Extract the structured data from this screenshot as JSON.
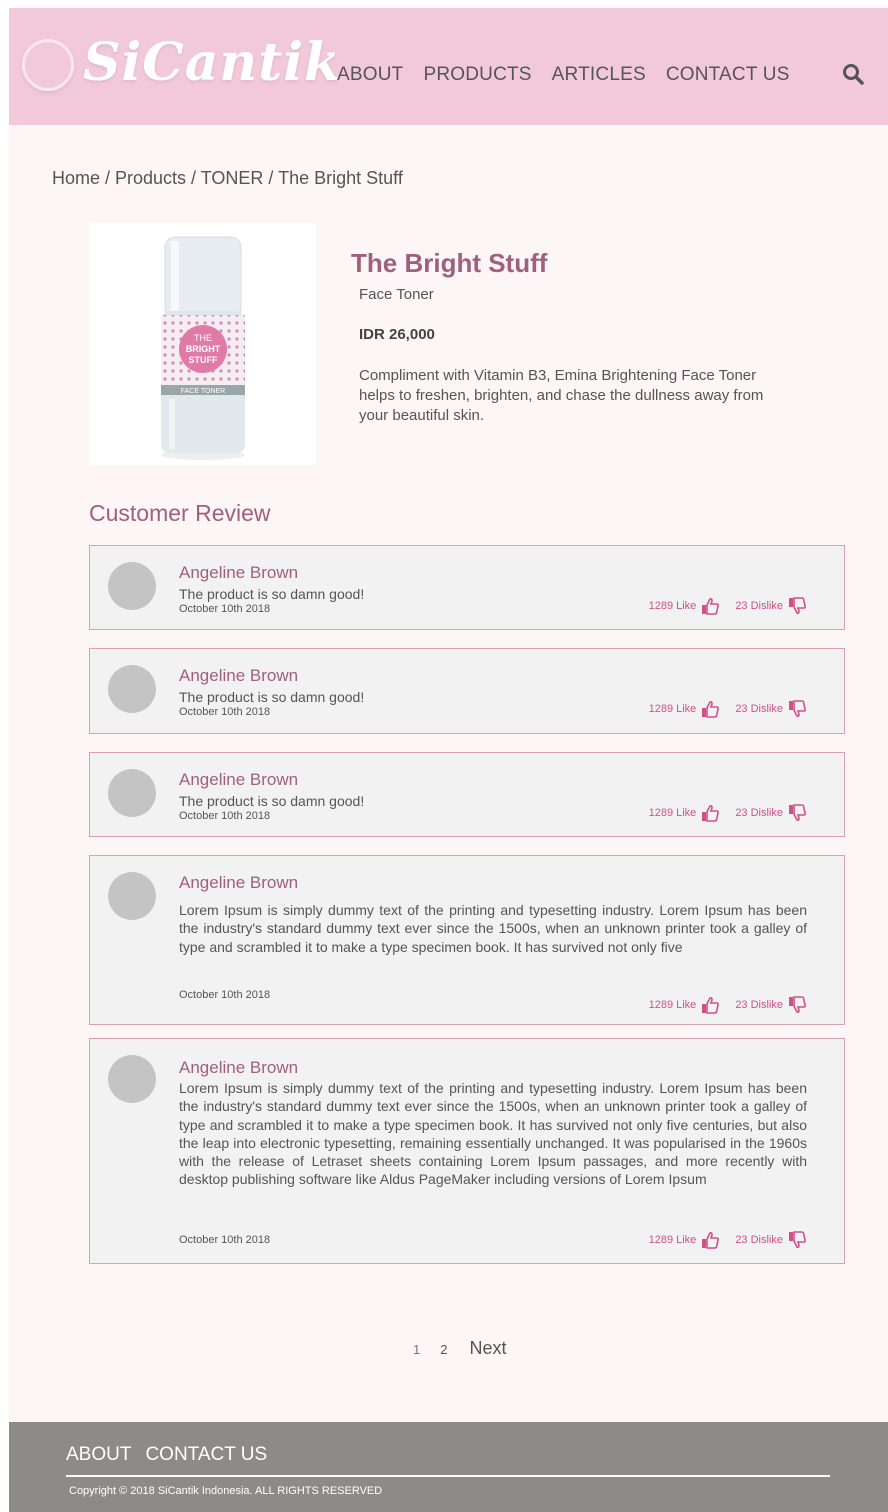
{
  "header": {
    "logo": "SiCantik",
    "nav": [
      "ABOUT",
      "PRODUCTS",
      "ARTICLES",
      "CONTACT US"
    ],
    "search_icon": "search-icon"
  },
  "breadcrumb": "Home / Products / TONER / The Bright Stuff",
  "product": {
    "title": "The Bright Stuff",
    "type": "Face Toner",
    "price": "IDR 26,000",
    "description": "Compliment with Vitamin B3, Emina Brightening Face Toner helps to freshen, brighten, and chase the dullness away from  your beautiful skin.",
    "image_label_1": "THE",
    "image_label_2": "BRIGHT",
    "image_label_3": "STUFF",
    "image_label_4": "FACE TONER"
  },
  "reviews_heading": "Customer Review",
  "reviews": [
    {
      "name": "Angeline Brown",
      "text": "The product is so damn good!",
      "date": "October 10th 2018",
      "likes": "1289 Like",
      "dislikes": "23 Dislike"
    },
    {
      "name": "Angeline Brown",
      "text": "The product is so damn good!",
      "date": "October 10th 2018",
      "likes": "1289 Like",
      "dislikes": "23 Dislike"
    },
    {
      "name": "Angeline Brown",
      "text": "The product is so damn good!",
      "date": "October 10th 2018",
      "likes": "1289 Like",
      "dislikes": "23 Dislike"
    },
    {
      "name": "Angeline Brown",
      "text": "Lorem Ipsum is simply dummy text of the printing and typesetting industry. Lorem Ipsum has been the industry's standard dummy text ever since the 1500s, when an unknown printer took a galley of type and scrambled it to make a type specimen book. It has survived not only five",
      "date": "October 10th 2018",
      "likes": "1289 Like",
      "dislikes": "23 Dislike"
    },
    {
      "name": "Angeline Brown",
      "text": "Lorem Ipsum is simply dummy text of the printing and typesetting industry. Lorem Ipsum has been the industry's standard dummy text ever since the 1500s, when an unknown printer took a galley of type and scrambled it to make a type specimen book. It has survived not only five centuries, but also the leap into electronic typesetting, remaining essentially unchanged. It was popularised in the 1960s with the release of Letraset sheets containing Lorem Ipsum passages, and more recently with desktop publishing software like Aldus PageMaker including versions of Lorem Ipsum",
      "date": "October 10th 2018",
      "likes": "1289 Like",
      "dislikes": "23 Dislike"
    }
  ],
  "pagination": {
    "pages": [
      "1",
      "2"
    ],
    "next": "Next"
  },
  "footer": {
    "links": [
      "ABOUT",
      "CONTACT US"
    ],
    "copyright": "Copyright © 2018 SiCantik Indonesia. ALL RIGHTS RESERVED"
  },
  "colors": {
    "header_bg": "#f2c9d8",
    "accent": "#a0607c",
    "vote_pink": "#d0508a",
    "footer_bg": "#8e8a8a"
  }
}
